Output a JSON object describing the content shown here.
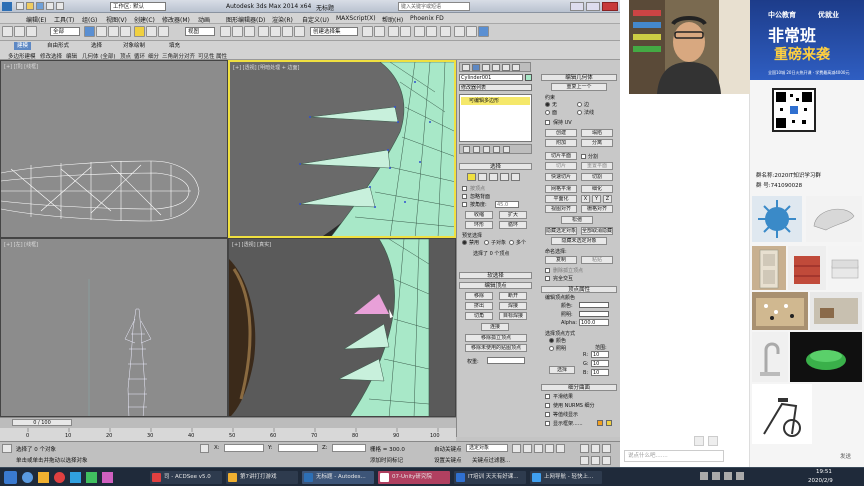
{
  "title": {
    "app": "Autodesk 3ds Max  2014 x64",
    "file": "无标题",
    "search_placeholder": "键入关键字或短语"
  },
  "menus": [
    "编辑(E)",
    "工具(T)",
    "组(G)",
    "视图(V)",
    "创建(C)",
    "修改器(M)",
    "动画",
    "图形编辑器(D)",
    "渲染(R)",
    "自定义(U)",
    "MAXScript(X)",
    "帮助(H)",
    "Phoenix FD"
  ],
  "toolbar": {
    "workspace": "工作区: 默认",
    "selection_filter": "全部",
    "ref_coord": "视图",
    "named_set": "创建选择集"
  },
  "ribbon": {
    "tabs": [
      "建模",
      "自由形式",
      "选择",
      "对象绘制",
      "填充"
    ],
    "active_tab": "建模",
    "subitems": [
      "多边形建模",
      "修改选择",
      "编辑",
      "几何体 (全部)",
      "顶点",
      "循环",
      "细分",
      "三角剖分",
      "对齐",
      "可见性",
      "属性"
    ]
  },
  "viewports": {
    "top_left": "[+] [顶] [线框]",
    "top_right": "[+] [透视] [明暗处理 + 边面]",
    "bottom_left": "[+] [左] [线框]",
    "bottom_right": "[+] [透视] [真实]"
  },
  "command_panel": {
    "object_name": "Cylinder001",
    "modifier_list": "修改器列表",
    "stack_item": "可编辑多边形",
    "selection_header": "选择",
    "by_vertex": "按顶点",
    "ignore_backfacing": "忽略背面",
    "by_angle": "按角度:",
    "angle_value": "45.0",
    "shrink": "收缩",
    "grow": "扩大",
    "ring": "环形",
    "loop": "循环",
    "preview_selection": "预览选择",
    "off": "禁用",
    "subobject": "子对象",
    "multi": "多个",
    "selected_count": "选择了 0 个顶点",
    "soft_selection": "软选择",
    "edit_vertices": "编辑顶点",
    "remove": "移除",
    "break": "断开",
    "extrude": "挤出",
    "weld": "焊接",
    "chamfer": "切角",
    "target_weld": "目标焊接",
    "connect": "连接",
    "remove_isolated": "移除孤立顶点",
    "remove_unused_map": "移除未使用的贴图顶点",
    "weight": "权重:",
    "edit_geometry": "编辑几何体",
    "repeat_last": "重复上一个",
    "constraints": "约束",
    "none": "无",
    "edge": "边",
    "face": "面",
    "normal": "法线",
    "preserve_uvs": "保持 UV",
    "create": "创建",
    "collapse": "塌陷",
    "attach": "附加",
    "detach": "分离",
    "slice_plane": "切片平面",
    "split": "分割",
    "slice": "切片",
    "reset_plane": "重置平面",
    "quickslice": "快速切片",
    "cut": "切割",
    "msmooth": "网格平滑",
    "tessellate": "细化",
    "planarize": "平面化",
    "x": "X",
    "y": "Y",
    "z": "Z",
    "view_align": "视图对齐",
    "grid_align": "栅格对齐",
    "relax": "松弛",
    "hide_selected": "隐藏选定对象",
    "unhide_all": "全部取消隐藏",
    "hide_unselected": "隐藏未选定对象",
    "named_selections": "命名选择:",
    "copy": "复制",
    "paste": "粘贴",
    "delete_isolated": "删除孤立顶点",
    "full_interactivity": "完全交互",
    "vertex_properties": "顶点属性",
    "edit_vertex_colors": "编辑顶点颜色",
    "color": "颜色:",
    "illumination": "照明:",
    "alpha": "Alpha:",
    "alpha_value": "100.0",
    "select_vertices_by": "选择顶点方式",
    "color_option": "颜色",
    "illum_option": "照明",
    "range": "范围:",
    "r": "R:",
    "g": "G:",
    "b": "B:",
    "range_value": "10",
    "select": "选择",
    "subdivision_surface": "细分曲面",
    "smooth_result": "平滑结果",
    "use_nurms": "使用 NURMS 细分",
    "isoline_display": "等值线显示",
    "show_cage": "显示框架......"
  },
  "timeline": {
    "frame": "0 / 100",
    "ticks": [
      "0",
      "10",
      "20",
      "30",
      "40",
      "50",
      "60",
      "70",
      "80",
      "90",
      "100"
    ]
  },
  "status": {
    "selected": "选择了 0 个对象",
    "prompt": "单击或单击并拖动以选择对象",
    "x_label": "X:",
    "y_label": "Y:",
    "z_label": "Z:",
    "grid": "栅格 = 300.0",
    "autokey": "自动关键点",
    "selected_obj": "选定对象",
    "set_key": "设置关键点",
    "key_filter": "关键点过滤器...",
    "add_time_tag": "添加时间标记"
  },
  "taskbar": {
    "items": [
      "司 - ACDSee v5.0",
      "第7讲打打游戏",
      "无标题 - Autodes...",
      "07-Unity研究院",
      "IT培训 天天有好课...",
      "上网导航 - 轻快上..."
    ],
    "clock": "19:51",
    "date": "2020/2/9"
  },
  "ads": {
    "brand": "中公教育",
    "brand2": "优就业",
    "headline1": "非常班",
    "headline2": "重磅来袭",
    "promo": "全国10城 20日火热开课 · 学费最高减4000元",
    "group": "群名称:2020IT知识学习群",
    "group_id": "群  号:741090028"
  },
  "chat": {
    "input_placeholder": "说点什么吧.......",
    "send": "发送"
  },
  "colors": {
    "mesh": "#a8e8c8",
    "accent": "#5d88c4",
    "highlight": "#f0e040"
  }
}
